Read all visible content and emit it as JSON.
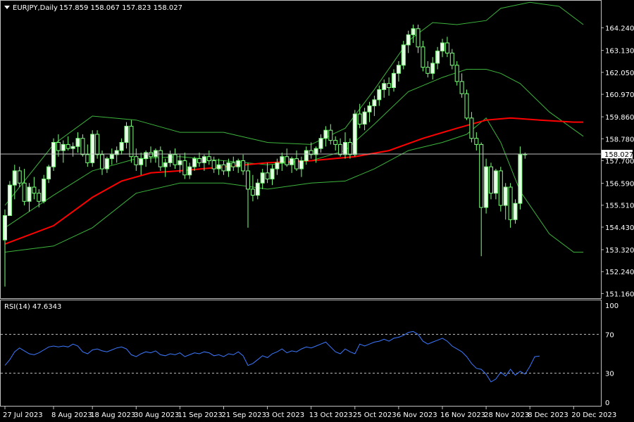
{
  "header": {
    "symbol": "EURJPY,Daily",
    "ohlc": "157.859 158.067 157.823 158.027"
  },
  "rsi_header": "RSI(14) 47.6343",
  "current_price_label": "158.027",
  "colors": {
    "background": "#000000",
    "frame": "#c0c0c0",
    "candle_bull": "#e8ffe8",
    "candle_bear": "#000000",
    "wick": "#7fff7f",
    "bollinger": "#3cb43c",
    "ma": "#ff0000",
    "rsi": "#3c78ff",
    "current_line": "#c0c0c0"
  },
  "icons": [
    "dropdown-triangle-icon"
  ],
  "chart_data": [
    {
      "type": "candlestick",
      "title": "EURJPY,Daily",
      "ylim": [
        151.0,
        164.85
      ],
      "yticks": [
        "164.240",
        "163.130",
        "162.050",
        "160.970",
        "159.860",
        "158.780",
        "157.700",
        "156.590",
        "155.510",
        "154.430",
        "153.320",
        "152.240",
        "151.160"
      ],
      "xticks": [
        "27 Jul 2023",
        "8 Aug 2023",
        "18 Aug 2023",
        "30 Aug 2023",
        "11 Sep 2023",
        "21 Sep 2023",
        "3 Oct 2023",
        "13 Oct 2023",
        "25 Oct 2023",
        "6 Nov 2023",
        "16 Nov 2023",
        "28 Nov 2023",
        "8 Dec 2023",
        "20 Dec 2023"
      ],
      "xtick_index": [
        0,
        10,
        18,
        27,
        36,
        45,
        54,
        63,
        72,
        81,
        90,
        99,
        108,
        117
      ],
      "current_price": 158.027,
      "candles": [
        [
          153.8,
          155.3,
          151.5,
          155.0
        ],
        [
          155.0,
          156.7,
          155.0,
          156.5
        ],
        [
          156.5,
          157.5,
          155.8,
          157.2
        ],
        [
          157.2,
          157.4,
          156.4,
          156.6
        ],
        [
          156.6,
          157.3,
          155.5,
          155.7
        ],
        [
          155.7,
          156.6,
          155.2,
          156.4
        ],
        [
          156.4,
          156.9,
          155.8,
          156.1
        ],
        [
          156.1,
          156.3,
          155.4,
          155.7
        ],
        [
          155.7,
          157.0,
          155.6,
          156.8
        ],
        [
          156.8,
          157.5,
          156.6,
          157.4
        ],
        [
          157.4,
          158.8,
          157.2,
          158.6
        ],
        [
          158.6,
          159.0,
          157.9,
          158.2
        ],
        [
          158.2,
          158.7,
          157.6,
          158.5
        ],
        [
          158.5,
          158.9,
          158.2,
          158.3
        ],
        [
          158.3,
          158.6,
          157.9,
          158.4
        ],
        [
          158.4,
          159.1,
          158.1,
          158.8
        ],
        [
          158.8,
          159.0,
          157.9,
          158.0
        ],
        [
          158.0,
          158.5,
          157.4,
          157.6
        ],
        [
          157.6,
          159.2,
          157.4,
          159.0
        ],
        [
          159.0,
          159.2,
          157.8,
          158.0
        ],
        [
          158.0,
          158.2,
          157.0,
          157.3
        ],
        [
          157.3,
          157.9,
          157.1,
          157.8
        ],
        [
          157.8,
          158.3,
          157.5,
          158.0
        ],
        [
          158.0,
          158.4,
          157.6,
          158.2
        ],
        [
          158.2,
          158.8,
          158.0,
          158.6
        ],
        [
          158.6,
          159.6,
          158.3,
          159.4
        ],
        [
          159.4,
          159.7,
          157.6,
          157.9
        ],
        [
          157.9,
          158.3,
          157.2,
          157.5
        ],
        [
          157.5,
          158.1,
          157.0,
          157.8
        ],
        [
          157.8,
          158.2,
          157.4,
          158.1
        ],
        [
          158.1,
          158.4,
          157.6,
          157.9
        ],
        [
          157.9,
          158.3,
          157.6,
          158.2
        ],
        [
          158.2,
          158.4,
          157.2,
          157.4
        ],
        [
          157.4,
          157.8,
          156.9,
          157.6
        ],
        [
          157.6,
          158.2,
          157.4,
          158.0
        ],
        [
          158.0,
          158.3,
          157.3,
          157.5
        ],
        [
          157.5,
          158.0,
          157.1,
          157.7
        ],
        [
          157.7,
          158.1,
          156.8,
          157.0
        ],
        [
          157.0,
          157.6,
          156.8,
          157.4
        ],
        [
          157.4,
          157.9,
          157.2,
          157.8
        ],
        [
          157.8,
          158.1,
          157.4,
          157.6
        ],
        [
          157.6,
          158.0,
          157.2,
          157.9
        ],
        [
          157.9,
          158.2,
          157.5,
          157.7
        ],
        [
          157.7,
          157.9,
          157.1,
          157.3
        ],
        [
          157.3,
          157.8,
          157.0,
          157.5
        ],
        [
          157.5,
          157.7,
          157.0,
          157.2
        ],
        [
          157.2,
          157.8,
          156.9,
          157.6
        ],
        [
          157.6,
          157.9,
          157.2,
          157.4
        ],
        [
          157.4,
          157.8,
          157.1,
          157.7
        ],
        [
          157.7,
          158.0,
          157.0,
          157.2
        ],
        [
          157.2,
          157.6,
          154.4,
          156.3
        ],
        [
          156.3,
          157.0,
          155.7,
          156.0
        ],
        [
          156.0,
          156.8,
          155.8,
          156.6
        ],
        [
          156.6,
          157.3,
          156.3,
          157.1
        ],
        [
          157.1,
          157.6,
          156.6,
          156.8
        ],
        [
          156.8,
          157.5,
          156.5,
          157.3
        ],
        [
          157.3,
          157.8,
          157.0,
          157.6
        ],
        [
          157.6,
          158.1,
          157.2,
          157.9
        ],
        [
          157.9,
          158.3,
          157.4,
          157.5
        ],
        [
          157.5,
          157.9,
          157.1,
          157.8
        ],
        [
          157.8,
          158.2,
          157.2,
          157.3
        ],
        [
          157.3,
          157.9,
          156.9,
          157.7
        ],
        [
          157.7,
          158.4,
          157.5,
          158.2
        ],
        [
          158.2,
          158.6,
          157.8,
          158.0
        ],
        [
          158.0,
          158.4,
          157.6,
          158.3
        ],
        [
          158.3,
          159.0,
          158.1,
          158.8
        ],
        [
          158.8,
          159.4,
          158.4,
          159.2
        ],
        [
          159.2,
          159.5,
          158.5,
          158.7
        ],
        [
          158.7,
          158.9,
          158.2,
          158.5
        ],
        [
          158.5,
          158.8,
          157.9,
          158.0
        ],
        [
          158.0,
          159.1,
          157.8,
          158.6
        ],
        [
          158.6,
          158.8,
          157.8,
          158.0
        ],
        [
          158.0,
          160.2,
          157.9,
          160.0
        ],
        [
          160.0,
          160.5,
          159.3,
          159.5
        ],
        [
          159.5,
          160.3,
          159.2,
          160.1
        ],
        [
          160.1,
          160.6,
          159.6,
          160.4
        ],
        [
          160.4,
          160.9,
          159.9,
          160.7
        ],
        [
          160.7,
          161.4,
          160.4,
          161.2
        ],
        [
          161.2,
          161.7,
          160.8,
          161.5
        ],
        [
          161.5,
          161.8,
          160.9,
          161.3
        ],
        [
          161.3,
          162.2,
          161.1,
          162.0
        ],
        [
          162.0,
          162.6,
          161.6,
          162.4
        ],
        [
          162.4,
          163.6,
          162.2,
          163.4
        ],
        [
          163.4,
          164.1,
          163.0,
          163.9
        ],
        [
          163.9,
          164.4,
          163.5,
          164.2
        ],
        [
          164.2,
          164.4,
          163.0,
          163.3
        ],
        [
          163.3,
          163.6,
          162.1,
          162.3
        ],
        [
          162.3,
          162.6,
          161.8,
          162.0
        ],
        [
          162.0,
          162.8,
          161.7,
          162.5
        ],
        [
          162.5,
          163.3,
          162.2,
          163.1
        ],
        [
          163.1,
          163.7,
          162.8,
          163.5
        ],
        [
          163.5,
          163.8,
          162.8,
          163.0
        ],
        [
          163.0,
          163.2,
          162.2,
          162.4
        ],
        [
          162.4,
          162.6,
          161.4,
          161.6
        ],
        [
          161.6,
          162.0,
          160.8,
          161.0
        ],
        [
          161.0,
          161.2,
          159.7,
          159.8
        ],
        [
          159.8,
          160.1,
          158.6,
          158.8
        ],
        [
          158.8,
          159.1,
          158.2,
          158.5
        ],
        [
          158.5,
          158.6,
          153.0,
          155.4
        ],
        [
          155.4,
          157.8,
          155.1,
          157.4
        ],
        [
          157.4,
          157.6,
          155.8,
          156.1
        ],
        [
          156.1,
          157.3,
          155.8,
          157.2
        ],
        [
          157.2,
          157.4,
          155.2,
          155.5
        ],
        [
          155.5,
          156.6,
          154.8,
          156.4
        ],
        [
          156.4,
          156.6,
          154.4,
          154.8
        ],
        [
          154.8,
          155.8,
          154.6,
          155.6
        ],
        [
          155.6,
          158.4,
          155.3,
          158.0
        ],
        [
          158.0,
          158.1,
          157.8,
          158.027
        ]
      ],
      "bollinger_upper": [
        [
          0,
          155.5
        ],
        [
          10,
          158.5
        ],
        [
          18,
          159.9
        ],
        [
          27,
          159.7
        ],
        [
          36,
          159.1
        ],
        [
          45,
          159.1
        ],
        [
          54,
          158.6
        ],
        [
          63,
          158.5
        ],
        [
          70,
          159.3
        ],
        [
          76,
          161.2
        ],
        [
          83,
          163.6
        ],
        [
          88,
          164.5
        ],
        [
          93,
          164.4
        ],
        [
          99,
          164.6
        ],
        [
          102,
          165.2
        ],
        [
          108,
          165.5
        ],
        [
          114,
          165.3
        ],
        [
          119,
          164.4
        ]
      ],
      "bollinger_middle": [
        [
          0,
          154.4
        ],
        [
          10,
          156.0
        ],
        [
          18,
          157.2
        ],
        [
          27,
          157.8
        ],
        [
          36,
          157.9
        ],
        [
          45,
          157.7
        ],
        [
          54,
          157.5
        ],
        [
          63,
          157.7
        ],
        [
          70,
          158.2
        ],
        [
          76,
          159.5
        ],
        [
          83,
          161.1
        ],
        [
          90,
          161.8
        ],
        [
          95,
          162.2
        ],
        [
          99,
          162.2
        ],
        [
          102,
          162.0
        ],
        [
          106,
          161.5
        ],
        [
          112,
          160.1
        ],
        [
          119,
          158.9
        ]
      ],
      "bollinger_lower": [
        [
          0,
          153.2
        ],
        [
          10,
          153.5
        ],
        [
          18,
          154.4
        ],
        [
          27,
          156.1
        ],
        [
          36,
          156.6
        ],
        [
          45,
          156.6
        ],
        [
          54,
          156.3
        ],
        [
          63,
          156.6
        ],
        [
          70,
          156.7
        ],
        [
          76,
          157.3
        ],
        [
          83,
          158.2
        ],
        [
          90,
          158.6
        ],
        [
          95,
          159.0
        ],
        [
          99,
          159.8
        ],
        [
          102,
          158.6
        ],
        [
          106,
          156.2
        ],
        [
          112,
          154.1
        ],
        [
          117,
          153.2
        ],
        [
          119,
          153.2
        ]
      ],
      "moving_average": [
        [
          0,
          153.6
        ],
        [
          10,
          154.5
        ],
        [
          18,
          155.9
        ],
        [
          24,
          156.7
        ],
        [
          30,
          157.1
        ],
        [
          36,
          157.2
        ],
        [
          45,
          157.4
        ],
        [
          54,
          157.6
        ],
        [
          63,
          157.7
        ],
        [
          72,
          157.9
        ],
        [
          79,
          158.2
        ],
        [
          86,
          158.8
        ],
        [
          93,
          159.3
        ],
        [
          99,
          159.7
        ],
        [
          104,
          159.8
        ],
        [
          110,
          159.7
        ],
        [
          117,
          159.6
        ],
        [
          119,
          159.6
        ]
      ]
    },
    {
      "type": "line",
      "title": "RSI(14) 47.6343",
      "ylim": [
        0,
        100
      ],
      "yticks": [
        100,
        70,
        30,
        0
      ],
      "levels": [
        70,
        30
      ],
      "series": [
        {
          "values": [
            38,
            44,
            52,
            56,
            53,
            50,
            49,
            51,
            54,
            57,
            58,
            57,
            58,
            57,
            60,
            58,
            52,
            50,
            54,
            55,
            53,
            52,
            54,
            56,
            57,
            55,
            49,
            47,
            50,
            52,
            51,
            53,
            49,
            48,
            50,
            49,
            51,
            47,
            49,
            51,
            50,
            52,
            51,
            48,
            49,
            47,
            50,
            49,
            52,
            48,
            38,
            40,
            44,
            48,
            46,
            50,
            52,
            55,
            51,
            53,
            52,
            55,
            57,
            56,
            58,
            60,
            62,
            57,
            52,
            50,
            55,
            52,
            50,
            60,
            58,
            60,
            62,
            63,
            65,
            63,
            66,
            67,
            69,
            72,
            73,
            70,
            63,
            60,
            62,
            64,
            66,
            63,
            58,
            55,
            52,
            47,
            40,
            35,
            34,
            29,
            21,
            24,
            31,
            27,
            34,
            28,
            32,
            29,
            37,
            47,
            47.6343
          ]
        }
      ]
    }
  ]
}
